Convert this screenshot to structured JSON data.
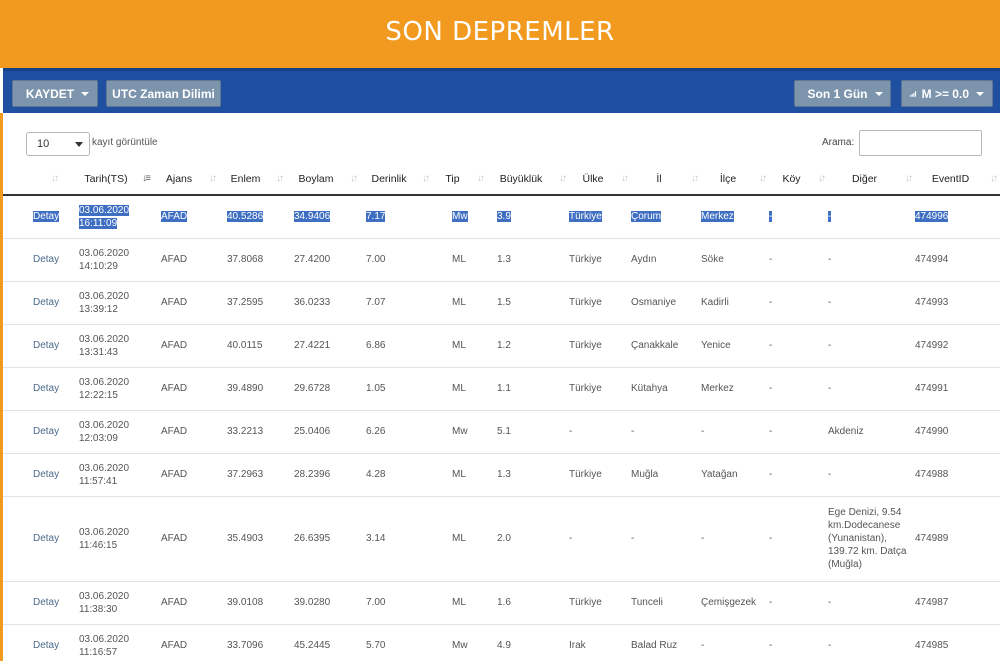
{
  "header": {
    "title": "SON DEPREMLER"
  },
  "toolbar": {
    "save_label": "KAYDET",
    "utc_label": "UTC Zaman Dilimi",
    "period_label": "Son 1 Gün",
    "magnitude_label": "M >= 0.0",
    "colors": {
      "banner": "#f29a1f",
      "toolbar": "#1e4fa0",
      "button": "#7d94ad",
      "highlight": "#3f6fc3"
    }
  },
  "controls": {
    "page_length_value": "10",
    "page_length_label": "kayıt görüntüle",
    "search_label": "Arama:",
    "search_value": ""
  },
  "table": {
    "columns": [
      "",
      "Tarih(TS)",
      "Ajans",
      "Enlem",
      "Boylam",
      "Derinlik",
      "Tip",
      "Büyüklük",
      "Ülke",
      "İl",
      "İlçe",
      "Köy",
      "Diğer",
      "EventID"
    ],
    "sorted_column": "Tarih(TS)",
    "rows": [
      {
        "detail": "Detay",
        "date": "03.06.2020",
        "time": "16:11:09",
        "agency": "AFAD",
        "lat": "40.5286",
        "lon": "34.9406",
        "depth": "7.17",
        "type": "Mw",
        "mag": "3.9",
        "country": "Türkiye",
        "city": "Çorum",
        "district": "Merkez",
        "village": "-",
        "other": "-",
        "event_id": "474996"
      },
      {
        "detail": "Detay",
        "date": "03.06.2020",
        "time": "14:10:29",
        "agency": "AFAD",
        "lat": "37.8068",
        "lon": "27.4200",
        "depth": "7.00",
        "type": "ML",
        "mag": "1.3",
        "country": "Türkiye",
        "city": "Aydın",
        "district": "Söke",
        "village": "-",
        "other": "-",
        "event_id": "474994"
      },
      {
        "detail": "Detay",
        "date": "03.06.2020",
        "time": "13:39:12",
        "agency": "AFAD",
        "lat": "37.2595",
        "lon": "36.0233",
        "depth": "7.07",
        "type": "ML",
        "mag": "1.5",
        "country": "Türkiye",
        "city": "Osmaniye",
        "district": "Kadirli",
        "village": "-",
        "other": "-",
        "event_id": "474993"
      },
      {
        "detail": "Detay",
        "date": "03.06.2020",
        "time": "13:31:43",
        "agency": "AFAD",
        "lat": "40.0115",
        "lon": "27.4221",
        "depth": "6.86",
        "type": "ML",
        "mag": "1.2",
        "country": "Türkiye",
        "city": "Çanakkale",
        "district": "Yenice",
        "village": "-",
        "other": "-",
        "event_id": "474992"
      },
      {
        "detail": "Detay",
        "date": "03.06.2020",
        "time": "12:22:15",
        "agency": "AFAD",
        "lat": "39.4890",
        "lon": "29.6728",
        "depth": "1.05",
        "type": "ML",
        "mag": "1.1",
        "country": "Türkiye",
        "city": "Kütahya",
        "district": "Merkez",
        "village": "-",
        "other": "-",
        "event_id": "474991"
      },
      {
        "detail": "Detay",
        "date": "03.06.2020",
        "time": "12:03:09",
        "agency": "AFAD",
        "lat": "33.2213",
        "lon": "25.0406",
        "depth": "6.26",
        "type": "Mw",
        "mag": "5.1",
        "country": "-",
        "city": "-",
        "district": "-",
        "village": "-",
        "other": "Akdeniz",
        "event_id": "474990"
      },
      {
        "detail": "Detay",
        "date": "03.06.2020",
        "time": "11:57:41",
        "agency": "AFAD",
        "lat": "37.2963",
        "lon": "28.2396",
        "depth": "4.28",
        "type": "ML",
        "mag": "1.3",
        "country": "Türkiye",
        "city": "Muğla",
        "district": "Yatağan",
        "village": "-",
        "other": "-",
        "event_id": "474988"
      },
      {
        "detail": "Detay",
        "date": "03.06.2020",
        "time": "11:46:15",
        "agency": "AFAD",
        "lat": "35.4903",
        "lon": "26.6395",
        "depth": "3.14",
        "type": "ML",
        "mag": "2.0",
        "country": "-",
        "city": "-",
        "district": "-",
        "village": "-",
        "other": "Ege Denizi, 9.54 km.Dodecanese (Yunanistan), 139.72 km. Datça (Muğla)",
        "event_id": "474989",
        "tall": true
      },
      {
        "detail": "Detay",
        "date": "03.06.2020",
        "time": "11:38:30",
        "agency": "AFAD",
        "lat": "39.0108",
        "lon": "39.0280",
        "depth": "7.00",
        "type": "ML",
        "mag": "1.6",
        "country": "Türkiye",
        "city": "Tunceli",
        "district": "Çemişgezek",
        "village": "-",
        "other": "-",
        "event_id": "474987"
      },
      {
        "detail": "Detay",
        "date": "03.06.2020",
        "time": "11:16:57",
        "agency": "AFAD",
        "lat": "33.7096",
        "lon": "45.2445",
        "depth": "5.70",
        "type": "Mw",
        "mag": "4.9",
        "country": "Irak",
        "city": "Balad Ruz",
        "district": "-",
        "village": "-",
        "other": "-",
        "event_id": "474985"
      }
    ]
  }
}
